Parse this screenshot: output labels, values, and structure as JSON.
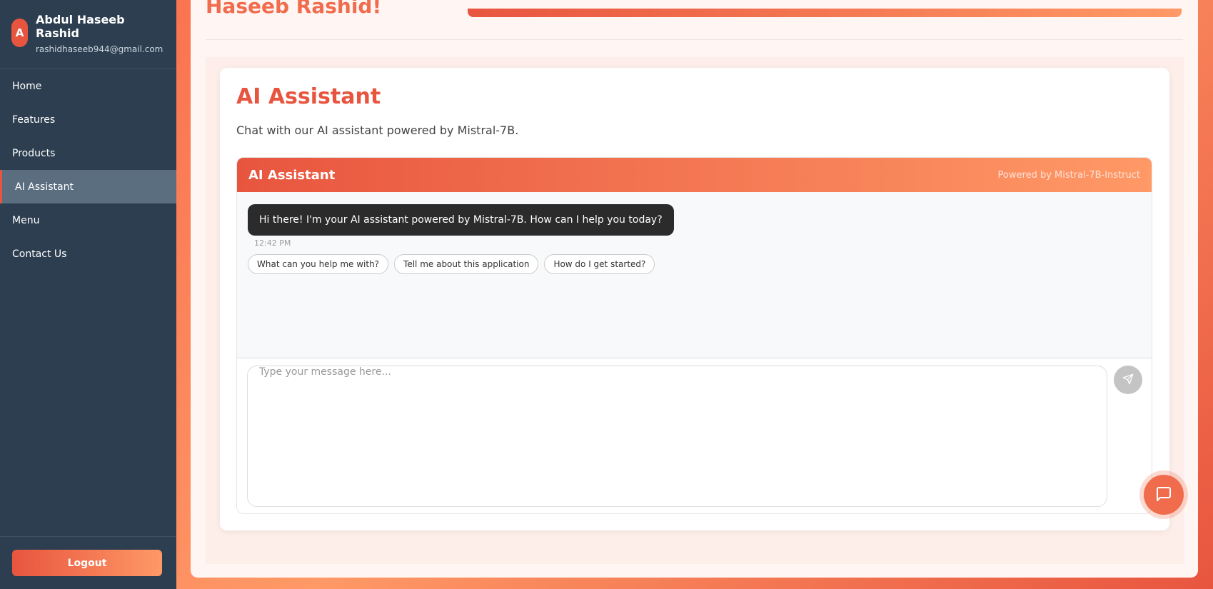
{
  "user": {
    "initial": "A",
    "name": "Abdul Haseeb Rashid",
    "email": "rashidhaseeb944@gmail.com"
  },
  "nav": {
    "items": [
      {
        "label": "Home"
      },
      {
        "label": "Features"
      },
      {
        "label": "Products"
      },
      {
        "label": "AI Assistant",
        "active": true
      },
      {
        "label": "Menu"
      },
      {
        "label": "Contact Us"
      }
    ]
  },
  "logout_label": "Logout",
  "greeting": "Haseeb Rashid!",
  "page": {
    "title": "AI Assistant",
    "subtitle": "Chat with our AI assistant powered by Mistral-7B."
  },
  "chat": {
    "title": "AI Assistant",
    "powered_by": "Powered by Mistral-7B-Instruct",
    "message": "Hi there! I'm your AI assistant powered by Mistral-7B. How can I help you today?",
    "time": "12:42 PM",
    "suggestions": [
      "What can you help me with?",
      "Tell me about this application",
      "How do I get started?"
    ],
    "input_placeholder": "Type your message here...",
    "input_value": ""
  },
  "colors": {
    "sidebar": "#2c3e50",
    "accent": "#e8553f",
    "accent_light": "#ff9966"
  },
  "icons": {
    "send": "send-icon",
    "chat_fab": "chat-bubble-icon"
  }
}
